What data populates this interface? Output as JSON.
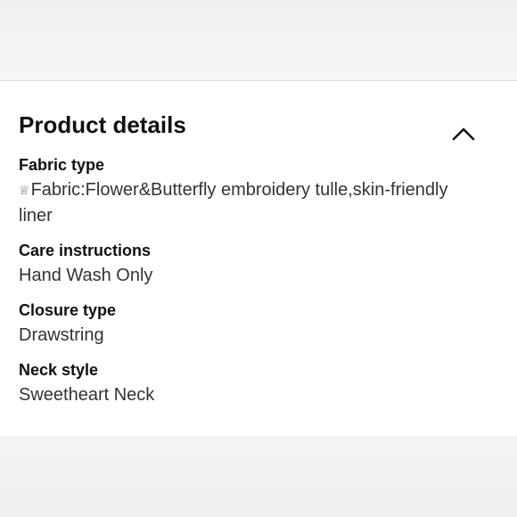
{
  "section": {
    "title": "Product details",
    "collapse_icon": "chevron-up-icon"
  },
  "details": [
    {
      "label": "Fabric type",
      "glyph": "♕",
      "value": "Fabric:Flower&Butterfly embroidery tulle,skin-friendly liner"
    },
    {
      "label": "Care instructions",
      "value": "Hand Wash Only"
    },
    {
      "label": "Closure type",
      "value": "Drawstring"
    },
    {
      "label": "Neck style",
      "value": "Sweetheart Neck"
    }
  ]
}
